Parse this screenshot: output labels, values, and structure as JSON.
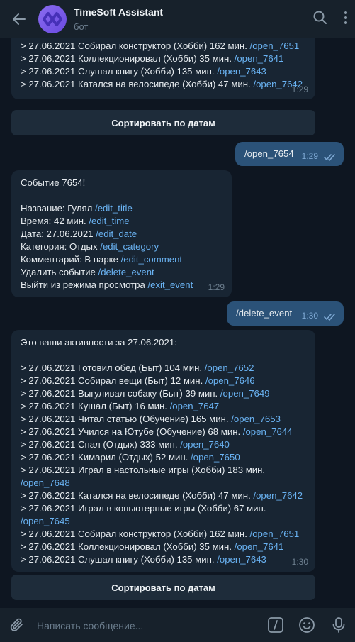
{
  "header": {
    "title": "TimeSoft Assistant",
    "subtitle": "бот"
  },
  "top_message": {
    "lines": [
      {
        "text": ">  27.06.2021 Собирал конструктор (Хобби) 162 мин. ",
        "link": "/open_7651"
      },
      {
        "text": ">  27.06.2021 Коллекционировал (Хобби) 35 мин. ",
        "link": "/open_7641"
      },
      {
        "text": ">  27.06.2021 Слушал книгу (Хобби) 135 мин. ",
        "link": "/open_7643"
      },
      {
        "text": ">  27.06.2021 Катался на велосипеде (Хобби) 47 мин. ",
        "link": "/open_7642"
      }
    ],
    "time": "1:29"
  },
  "sort_button_label": "Сортировать по датам",
  "outgoing_1": {
    "text": "/open_7654",
    "time": "1:29"
  },
  "event_message": {
    "title": "Событие 7654!",
    "lines": [
      {
        "text": "Название: Гулял ",
        "link": "/edit_title"
      },
      {
        "text": "Время: 42 мин. ",
        "link": "/edit_time"
      },
      {
        "text": "Дата: 27.06.2021 ",
        "link": "/edit_date"
      },
      {
        "text": "Категория: Отдых ",
        "link": "/edit_category"
      },
      {
        "text": "Комментарий: В парке ",
        "link": "/edit_comment"
      },
      {
        "text": "Удалить событие ",
        "link": "/delete_event"
      },
      {
        "text": "Выйти из режима просмотра ",
        "link": "/exit_event"
      }
    ],
    "time": "1:29"
  },
  "outgoing_2": {
    "text": "/delete_event",
    "time": "1:30"
  },
  "activities_message": {
    "title": "Это ваши активности за 27.06.2021:",
    "lines": [
      {
        "text": ">  27.06.2021 Готовил обед (Быт) 104 мин. ",
        "link": "/open_7652"
      },
      {
        "text": ">  27.06.2021 Собирал вещи (Быт) 12 мин. ",
        "link": "/open_7646"
      },
      {
        "text": ">  27.06.2021 Выгуливал собаку (Быт) 39 мин. ",
        "link": "/open_7649"
      },
      {
        "text": ">  27.06.2021 Кушал (Быт) 16 мин. ",
        "link": "/open_7647"
      },
      {
        "text": ">  27.06.2021 Читал статью (Обучение) 165 мин. ",
        "link": "/open_7653"
      },
      {
        "text": ">  27.06.2021 Учился на Ютубе (Обучение) 68 мин. ",
        "link": "/open_7644"
      },
      {
        "text": ">  27.06.2021 Спал (Отдых) 333 мин. ",
        "link": "/open_7640"
      },
      {
        "text": ">  27.06.2021 Кимарил (Отдых) 52 мин. ",
        "link": "/open_7650"
      },
      {
        "text": ">  27.06.2021 Играл в настольные игры (Хобби) 183 мин.",
        "link": ""
      },
      {
        "text": "",
        "link": "/open_7648"
      },
      {
        "text": ">  27.06.2021 Катался на велосипеде (Хобби) 47 мин. ",
        "link": "/open_7642"
      },
      {
        "text": ">  27.06.2021 Играл в копьютерные игры (Хобби) 67 мин.",
        "link": ""
      },
      {
        "text": "",
        "link": "/open_7645"
      },
      {
        "text": ">  27.06.2021 Собирал конструктор (Хобби) 162 мин. ",
        "link": "/open_7651"
      },
      {
        "text": ">  27.06.2021 Коллекционировал (Хобби) 35 мин. ",
        "link": "/open_7641"
      },
      {
        "text": ">  27.06.2021 Слушал книгу (Хобби) 135 мин. ",
        "link": "/open_7643"
      }
    ],
    "time": "1:30"
  },
  "composer": {
    "placeholder": "Написать сообщение..."
  },
  "icons": {
    "back": "arrow-left-icon",
    "avatar": "bot-logo-icon",
    "search": "search-icon",
    "menu": "more-vertical-icon",
    "attach": "paperclip-icon",
    "commands": "slash-command-icon",
    "emoji": "smile-icon",
    "mic": "microphone-icon",
    "read": "double-check-icon"
  },
  "colors": {
    "background": "#0e1621",
    "header": "#17212b",
    "incoming_bubble": "#182533",
    "outgoing_bubble": "#2b5278",
    "link": "#6ab3f3"
  }
}
